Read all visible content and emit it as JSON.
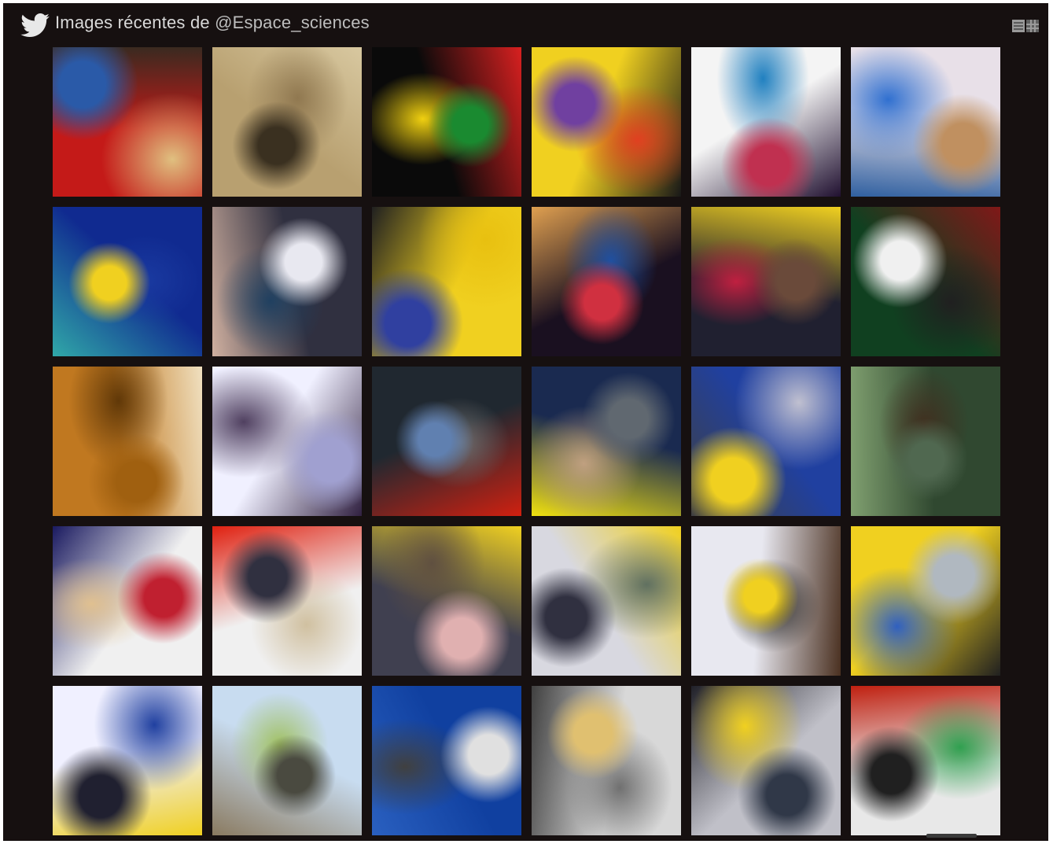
{
  "header": {
    "title_prefix": "Images récentes de ",
    "handle": "@Espace_sciences",
    "icon": "twitter-bird-icon"
  },
  "view_toggles": [
    {
      "icon": "list-view-icon"
    },
    {
      "icon": "grid-view-icon"
    }
  ],
  "photos": [
    {
      "colors": [
        "#c41a18",
        "#3a2a20",
        "#2a5aa8",
        "#e0c080"
      ],
      "icon": "photo-thumbnail"
    },
    {
      "colors": [
        "#b8a070",
        "#d8c8a0",
        "#3a3020",
        "#907850"
      ],
      "icon": "photo-thumbnail"
    },
    {
      "colors": [
        "#0a0a0a",
        "#d82020",
        "#1a8a30",
        "#f0d010"
      ],
      "icon": "photo-thumbnail"
    },
    {
      "colors": [
        "#f0d020",
        "#181818",
        "#7040a0",
        "#e04020"
      ],
      "icon": "photo-thumbnail"
    },
    {
      "colors": [
        "#f4f4f4",
        "#201030",
        "#c03050",
        "#2080c0"
      ],
      "icon": "photo-thumbnail"
    },
    {
      "colors": [
        "#e8e0e8",
        "#3060a0",
        "#c09060",
        "#3070d0"
      ],
      "icon": "photo-thumbnail"
    },
    {
      "colors": [
        "#102a90",
        "#30a8a8",
        "#f0d020",
        "#1a3aa0"
      ],
      "icon": "photo-thumbnail"
    },
    {
      "colors": [
        "#303040",
        "#d0b0a0",
        "#e8e8f0",
        "#204060"
      ],
      "icon": "photo-thumbnail"
    },
    {
      "colors": [
        "#f0d020",
        "#202020",
        "#3040a0",
        "#e8c010"
      ],
      "icon": "photo-thumbnail"
    },
    {
      "colors": [
        "#1a1020",
        "#e0a050",
        "#d03040",
        "#2050a0"
      ],
      "icon": "photo-thumbnail"
    },
    {
      "colors": [
        "#202030",
        "#f0d020",
        "#6a4a3a",
        "#c02040"
      ],
      "icon": "photo-thumbnail"
    },
    {
      "colors": [
        "#104020",
        "#801818",
        "#f0f0f0",
        "#202020"
      ],
      "icon": "photo-thumbnail"
    },
    {
      "colors": [
        "#c07820",
        "#f0e0c0",
        "#a06010",
        "#603808"
      ],
      "icon": "photo-thumbnail"
    },
    {
      "colors": [
        "#f0f0ff",
        "#302040",
        "#a0a0d0",
        "#504060"
      ],
      "icon": "photo-thumbnail"
    },
    {
      "colors": [
        "#202830",
        "#d02010",
        "#6080b0",
        "#707070"
      ],
      "icon": "photo-thumbnail"
    },
    {
      "colors": [
        "#1a2a50",
        "#f0e010",
        "#606870",
        "#c0a080"
      ],
      "icon": "photo-thumbnail"
    },
    {
      "colors": [
        "#2040a0",
        "#404040",
        "#f0d020",
        "#c0c0d0"
      ],
      "icon": "photo-thumbnail"
    },
    {
      "colors": [
        "#304830",
        "#80a070",
        "#506850",
        "#403020"
      ],
      "icon": "photo-thumbnail"
    },
    {
      "colors": [
        "#f0f0f0",
        "#1a1a60",
        "#c02030",
        "#e0c090"
      ],
      "icon": "photo-thumbnail"
    },
    {
      "colors": [
        "#f0f0f0",
        "#e02010",
        "#303040",
        "#d0c0a0"
      ],
      "icon": "photo-thumbnail"
    },
    {
      "colors": [
        "#404050",
        "#f0d020",
        "#e0b0b0",
        "#605040"
      ],
      "icon": "photo-thumbnail"
    },
    {
      "colors": [
        "#d8d8e0",
        "#f0d020",
        "#303040",
        "#607060"
      ],
      "icon": "photo-thumbnail"
    },
    {
      "colors": [
        "#e8e8f0",
        "#4a3020",
        "#f0d020",
        "#202020"
      ],
      "icon": "photo-thumbnail"
    },
    {
      "colors": [
        "#f0d020",
        "#202020",
        "#b0b8c0",
        "#3060c0"
      ],
      "icon": "photo-thumbnail"
    },
    {
      "colors": [
        "#f0f0ff",
        "#f0d020",
        "#202030",
        "#2040a0"
      ],
      "icon": "photo-thumbnail"
    },
    {
      "colors": [
        "#c8dcf0",
        "#8a7a60",
        "#4a4a40",
        "#a0c060"
      ],
      "icon": "photo-thumbnail"
    },
    {
      "colors": [
        "#1040a0",
        "#2a60c0",
        "#e0e0e0",
        "#404040"
      ],
      "icon": "photo-thumbnail"
    },
    {
      "colors": [
        "#d8d8d8",
        "#404040",
        "#e0c070",
        "#707070"
      ],
      "icon": "photo-thumbnail"
    },
    {
      "colors": [
        "#c0c0c8",
        "#202028",
        "#303848",
        "#f0d020"
      ],
      "icon": "photo-thumbnail"
    },
    {
      "colors": [
        "#e8e8e8",
        "#c02010",
        "#202020",
        "#30a050"
      ],
      "icon": "photo-thumbnail"
    }
  ]
}
